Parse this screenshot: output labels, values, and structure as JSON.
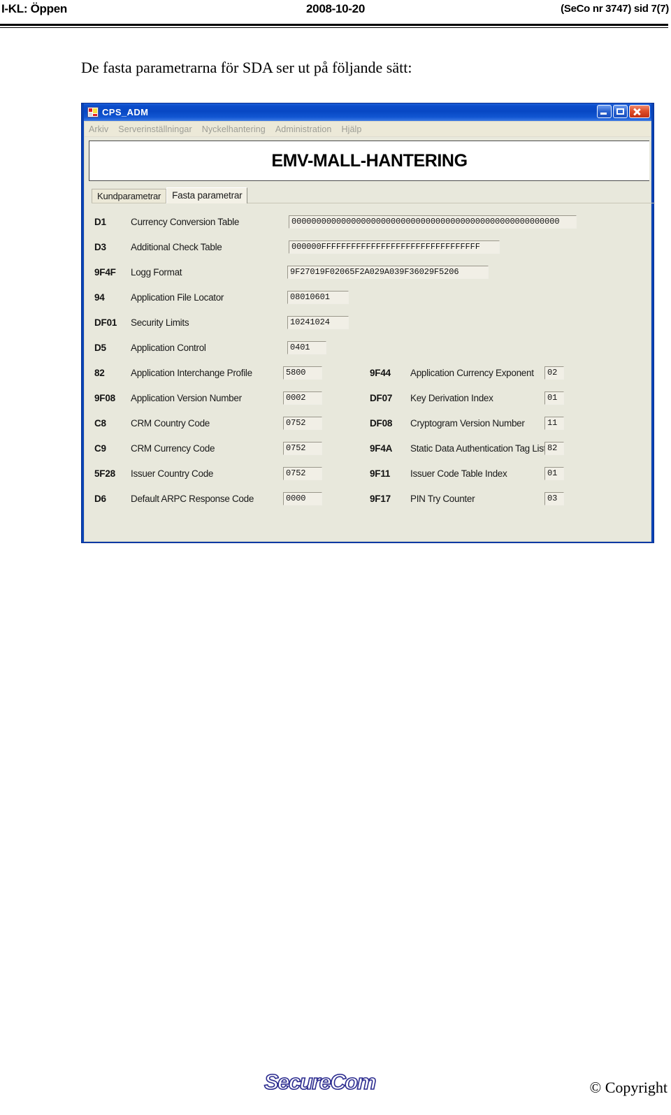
{
  "page_header": {
    "left": "I-KL: Öppen",
    "center": "2008-10-20",
    "right": "(SeCo nr 3747) sid 7(7)"
  },
  "intro_text": "De fasta parametrarna för SDA ser ut på följande sätt:",
  "window": {
    "title": "CPS_ADM",
    "icon": "app-squares-icon",
    "minimize_label": "",
    "maximize_label": "",
    "close_label": "",
    "menu": [
      {
        "label": "Arkiv"
      },
      {
        "label": "Serverinställningar"
      },
      {
        "label": "Nyckelhantering"
      },
      {
        "label": "Administration"
      },
      {
        "label": "Hjälp"
      }
    ],
    "banner_title": "EMV-MALL-HANTERING",
    "tabs": [
      {
        "label": "Kundparametrar",
        "active": false
      },
      {
        "label": "Fasta parametrar",
        "active": true
      }
    ],
    "single_rows": [
      {
        "tag": "D1",
        "label": "Currency Conversion Table",
        "value": "000000000000000000000000000000000000000000000000000000",
        "field_class": "f-d1"
      },
      {
        "tag": "D3",
        "label": "Additional Check Table",
        "value": "000000FFFFFFFFFFFFFFFFFFFFFFFFFFFFFFFF",
        "field_class": "f-d3"
      },
      {
        "tag": "9F4F",
        "label": "Logg Format",
        "value": "9F27019F02065F2A029A039F36029F5206",
        "field_class": "f-9f4f"
      },
      {
        "tag": "94",
        "label": "Application File Locator",
        "value": "08010601",
        "field_class": "f-94"
      },
      {
        "tag": "DF01",
        "label": "Security Limits",
        "value": "10241024",
        "field_class": "f-df01"
      },
      {
        "tag": "D5",
        "label": "Application Control",
        "value": "0401",
        "field_class": "f-d5"
      }
    ],
    "paired_rows": [
      {
        "left": {
          "tag": "82",
          "label": "Application Interchange Profile",
          "value": "5800"
        },
        "right": {
          "tag": "9F44",
          "label": "Application Currency Exponent",
          "value": "02"
        }
      },
      {
        "left": {
          "tag": "9F08",
          "label": "Application Version Number",
          "value": "0002"
        },
        "right": {
          "tag": "DF07",
          "label": "Key Derivation Index",
          "value": "01"
        }
      },
      {
        "left": {
          "tag": "C8",
          "label": "CRM Country Code",
          "value": "0752"
        },
        "right": {
          "tag": "DF08",
          "label": "Cryptogram Version Number",
          "value": "11"
        }
      },
      {
        "left": {
          "tag": "C9",
          "label": "CRM Currency Code",
          "value": "0752"
        },
        "right": {
          "tag": "9F4A",
          "label": "Static Data Authentication Tag List",
          "value": "82"
        }
      },
      {
        "left": {
          "tag": "5F28",
          "label": "Issuer Country Code",
          "value": "0752"
        },
        "right": {
          "tag": "9F11",
          "label": "Issuer Code Table Index",
          "value": "01"
        }
      },
      {
        "left": {
          "tag": "D6",
          "label": "Default ARPC Response Code",
          "value": "0000"
        },
        "right": {
          "tag": "9F17",
          "label": "PIN Try Counter",
          "value": "03"
        }
      }
    ]
  },
  "footer": {
    "logo_text": "SecureCom",
    "copyright": "© Copyright"
  },
  "colors": {
    "titlebar_blue": "#0a4ccb",
    "window_chrome": "#ece9d8",
    "window_body": "#e8e8dc",
    "close_red": "#e0502a",
    "logo_blue": "#2b2b8f"
  }
}
